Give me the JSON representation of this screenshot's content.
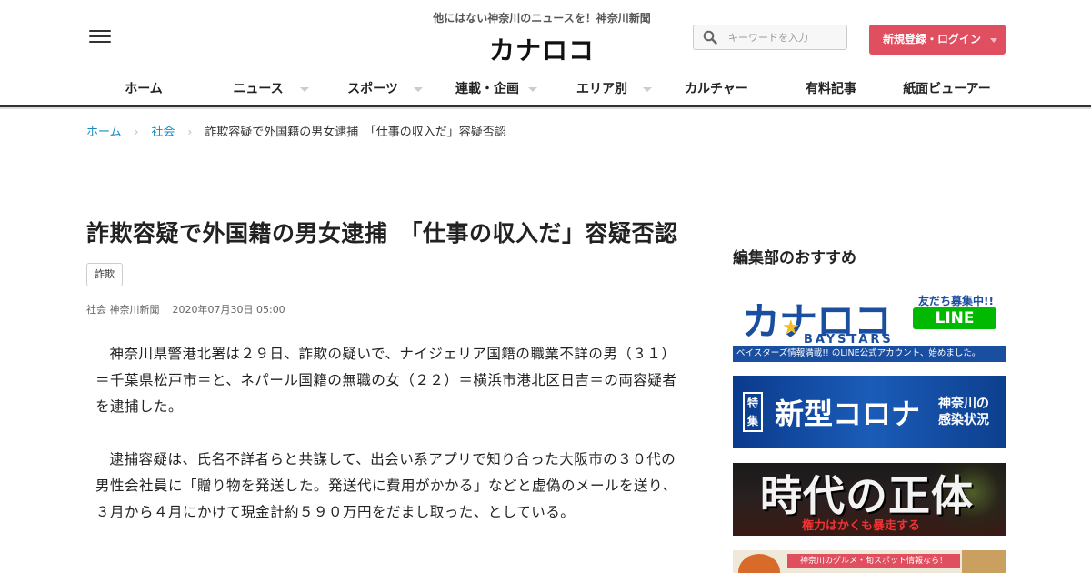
{
  "header": {
    "tagline": "他にはない神奈川のニュースを！神奈川新聞",
    "logo": "カナロコ",
    "search_placeholder": "キーワードを入力",
    "login_label": "新規登録・ログイン"
  },
  "nav": {
    "items": [
      {
        "label": "ホーム"
      },
      {
        "label": "ニュース"
      },
      {
        "label": "スポーツ"
      },
      {
        "label": "連載・企画"
      },
      {
        "label": "エリア別"
      },
      {
        "label": "カルチャー"
      },
      {
        "label": "有料記事"
      },
      {
        "label": "紙面ビューアー"
      }
    ]
  },
  "breadcrumb": {
    "home": "ホーム",
    "category": "社会",
    "current": "詐欺容疑で外国籍の男女逮捕　「仕事の収入だ」容疑否認"
  },
  "article": {
    "title": "詐欺容疑で外国籍の男女逮捕　「仕事の収入だ」容疑否認",
    "tag": "詐欺",
    "category": "社会",
    "source": "神奈川新聞",
    "date": "2020年07月30日 05:00",
    "paragraphs": [
      "神奈川県警港北署は２９日、詐欺の疑いで、ナイジェリア国籍の職業不詳の男（３１）＝千葉県松戸市＝と、ネパール国籍の無職の女（２２）＝横浜市港北区日吉＝の両容疑者を逮捕した。",
      "逮捕容疑は、氏名不詳者らと共謀して、出会い系アプリで知り合った大阪市の３０代の男性会社員に「贈り物を発送した。発送代に費用がかかる」などと虚偽のメールを送り、３月から４月にかけて現金計約５９０万円をだまし取った、としている。"
    ]
  },
  "sidebar": {
    "heading": "編集部のおすすめ",
    "banner1": {
      "logo": "カナロコ",
      "friends": "友だち募集中!!",
      "line": "LINE",
      "team": "BAYSTARS",
      "strip": "ベイスターズ情報満載!! のLINE公式アカウント、始めました。"
    },
    "banner2": {
      "badge": "特集",
      "title": "新型コロナ",
      "sub1": "神奈川の",
      "sub2": "感染状況"
    },
    "banner3": {
      "title": "時代の正体",
      "sub": "権力はかくも暴走する"
    },
    "banner4": {
      "ribbon": "神奈川のグルメ・旬スポット情報なら！"
    }
  },
  "colors": {
    "accent_red": "#e04f5f",
    "link_blue": "#1a8ac8",
    "line_green": "#00b900",
    "brand_blue": "#1a4ea0"
  }
}
